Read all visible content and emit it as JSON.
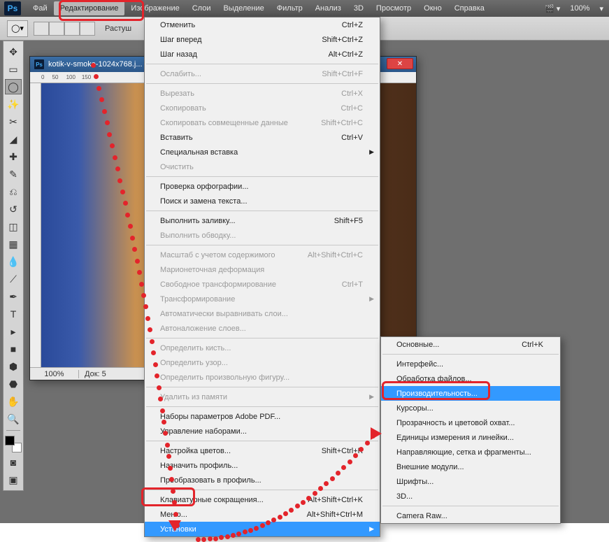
{
  "menubar": {
    "items": [
      "Фай",
      "Редактирование",
      "Изображение",
      "Слои",
      "Выделение",
      "Фильтр",
      "Анализ",
      "3D",
      "Просмотр",
      "Окно",
      "Справка"
    ],
    "active_index": 1,
    "zoom": "100%"
  },
  "optionsbar": {
    "label": "Растуш"
  },
  "toolbox_icons": [
    "▭",
    "⬚",
    "◯",
    "✎",
    "⬛",
    "✂",
    "✒",
    "↺",
    "⊥",
    "✦",
    "⌫",
    "◔",
    "▤",
    "✎",
    "T",
    "▸",
    "▭",
    "✋",
    "🔍"
  ],
  "document": {
    "title": "kotik-v-smoke-1024x768.j...",
    "zoom": "100%",
    "status": "Док: 5"
  },
  "edit_menu": {
    "groups": [
      [
        {
          "label": "Отменить",
          "shortcut": "Ctrl+Z"
        },
        {
          "label": "Шаг вперед",
          "shortcut": "Shift+Ctrl+Z"
        },
        {
          "label": "Шаг назад",
          "shortcut": "Alt+Ctrl+Z"
        }
      ],
      [
        {
          "label": "Ослабить...",
          "shortcut": "Shift+Ctrl+F",
          "disabled": true
        }
      ],
      [
        {
          "label": "Вырезать",
          "shortcut": "Ctrl+X",
          "disabled": true
        },
        {
          "label": "Скопировать",
          "shortcut": "Ctrl+C",
          "disabled": true
        },
        {
          "label": "Скопировать совмещенные данные",
          "shortcut": "Shift+Ctrl+C",
          "disabled": true
        },
        {
          "label": "Вставить",
          "shortcut": "Ctrl+V"
        },
        {
          "label": "Специальная вставка",
          "submenu": true
        },
        {
          "label": "Очистить",
          "disabled": true
        }
      ],
      [
        {
          "label": "Проверка орфографии..."
        },
        {
          "label": "Поиск и замена текста..."
        }
      ],
      [
        {
          "label": "Выполнить заливку...",
          "shortcut": "Shift+F5"
        },
        {
          "label": "Выполнить обводку...",
          "disabled": true
        }
      ],
      [
        {
          "label": "Масштаб с учетом содержимого",
          "shortcut": "Alt+Shift+Ctrl+C",
          "disabled": true
        },
        {
          "label": "Марионеточная деформация",
          "disabled": true
        },
        {
          "label": "Свободное трансформирование",
          "shortcut": "Ctrl+T",
          "disabled": true
        },
        {
          "label": "Трансформирование",
          "submenu": true,
          "disabled": true
        },
        {
          "label": "Автоматически выравнивать слои...",
          "disabled": true
        },
        {
          "label": "Автоналожение слоев...",
          "disabled": true
        }
      ],
      [
        {
          "label": "Определить кисть...",
          "disabled": true
        },
        {
          "label": "Определить узор...",
          "disabled": true
        },
        {
          "label": "Определить произвольную фигуру...",
          "disabled": true
        }
      ],
      [
        {
          "label": "Удалить из памяти",
          "submenu": true,
          "disabled": true
        }
      ],
      [
        {
          "label": "Наборы параметров Adobe PDF..."
        },
        {
          "label": "Управление наборами..."
        }
      ],
      [
        {
          "label": "Настройка цветов...",
          "shortcut": "Shift+Ctrl+K"
        },
        {
          "label": "Назначить профиль..."
        },
        {
          "label": "Преобразовать в профиль..."
        }
      ],
      [
        {
          "label": "Клавиатурные сокращения...",
          "shortcut": "Alt+Shift+Ctrl+K"
        },
        {
          "label": "Меню...",
          "shortcut": "Alt+Shift+Ctrl+M"
        },
        {
          "label": "Установки",
          "submenu": true,
          "highlight": true
        }
      ]
    ]
  },
  "prefs_menu": {
    "groups": [
      [
        {
          "label": "Основные...",
          "shortcut": "Ctrl+K"
        }
      ],
      [
        {
          "label": "Интерфейс..."
        },
        {
          "label": "Обработка файлов..."
        },
        {
          "label": "Производительность...",
          "highlight": true
        },
        {
          "label": "Курсоры..."
        },
        {
          "label": "Прозрачность и цветовой охват..."
        },
        {
          "label": "Единицы измерения и линейки..."
        },
        {
          "label": "Направляющие, сетка и фрагменты..."
        },
        {
          "label": "Внешние модули..."
        },
        {
          "label": "Шрифты..."
        },
        {
          "label": "3D..."
        }
      ],
      [
        {
          "label": "Camera Raw..."
        }
      ]
    ]
  }
}
